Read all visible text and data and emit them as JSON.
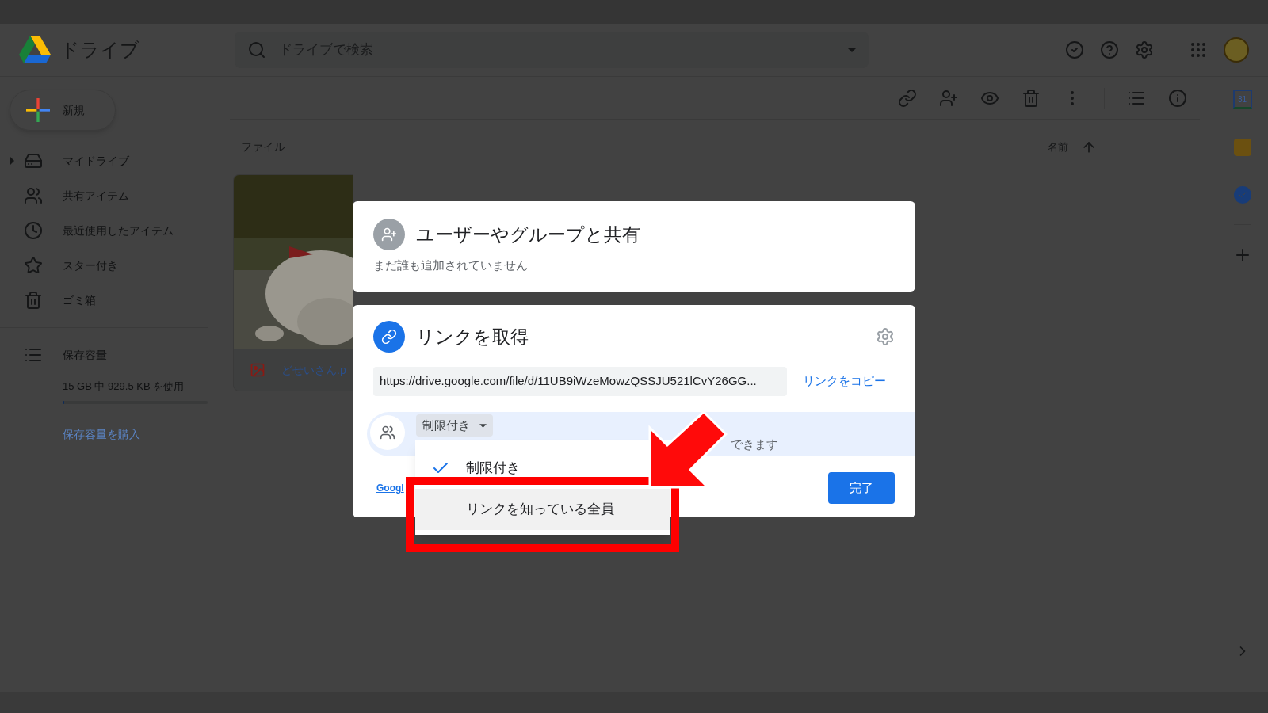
{
  "app": {
    "title": "ドライブ",
    "search_placeholder": "ドライブで検索"
  },
  "new_button": "新規",
  "sidebar": {
    "items": [
      {
        "kind": "drive",
        "label": "マイドライブ",
        "expandable": true
      },
      {
        "kind": "shared",
        "label": "共有アイテム",
        "expandable": false
      },
      {
        "kind": "recent",
        "label": "最近使用したアイテム",
        "expandable": false
      },
      {
        "kind": "star",
        "label": "スター付き",
        "expandable": false
      },
      {
        "kind": "trash",
        "label": "ゴミ箱",
        "expandable": false
      }
    ],
    "storage": {
      "label": "保存容量",
      "usage": "15 GB 中 929.5 KB を使用",
      "level": 0.01,
      "buy_link": "保存容量を購入"
    }
  },
  "main": {
    "section": "ファイル",
    "sort": "名前",
    "file": {
      "name": "どせいさん.p"
    }
  },
  "right_rail": {
    "calendar_day": "31"
  },
  "share_dialog": {
    "people": {
      "title": "ユーザーやグループと共有",
      "subtitle": "まだ誰も追加されていません"
    },
    "link": {
      "title": "リンクを取得",
      "url": "https://drive.google.com/file/d/11UB9iWzeMowzQSSJU521lCvY26GG...",
      "copy": "リンクをコピー",
      "access_button": "制限付き",
      "access_note": "できます",
      "footer_link": "Googl",
      "done": "完了"
    },
    "access_menu": [
      {
        "label": "制限付き",
        "selected": true,
        "highlighted": false
      },
      {
        "label": "リンクを知っている全員",
        "selected": false,
        "highlighted": true
      }
    ]
  }
}
